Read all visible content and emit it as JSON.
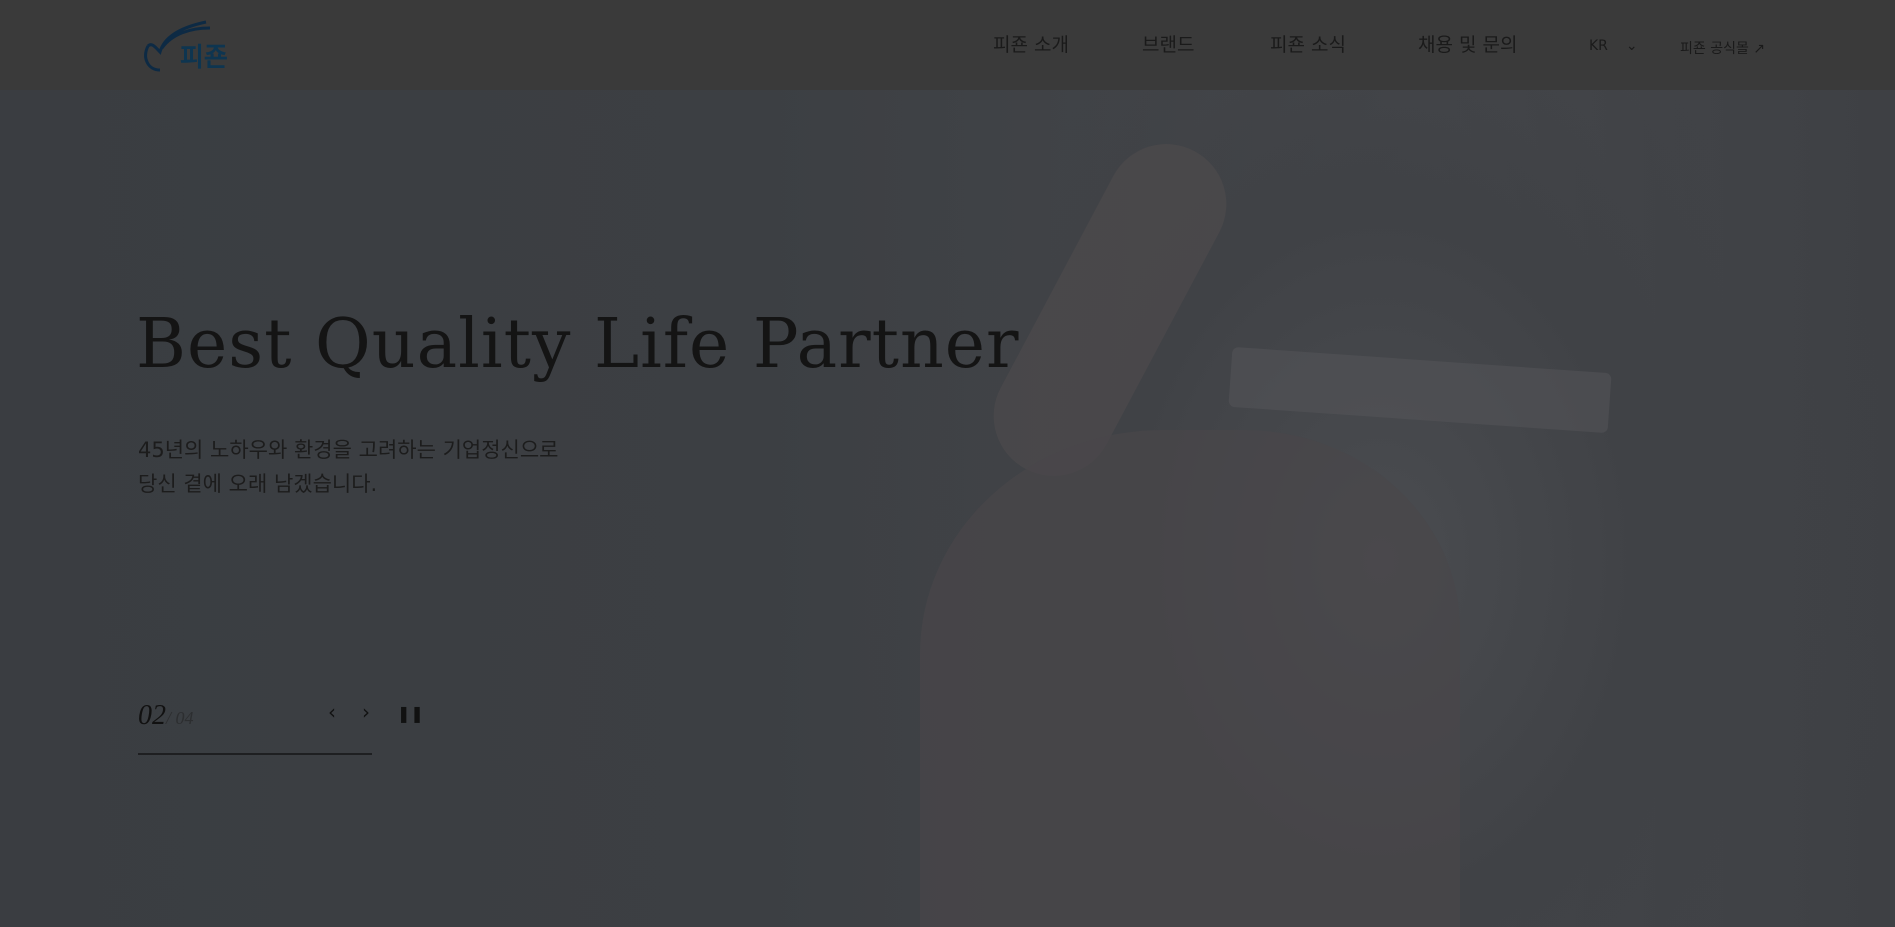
{
  "header": {
    "logo_text": "피죤",
    "nav": [
      "피죤 소개",
      "브랜드",
      "피죤 소식",
      "채용 및 문의"
    ],
    "lang": "KR",
    "shop_link": "피죤 공식몰 ↗"
  },
  "hero": {
    "title": "Best Quality Life Partner",
    "subtitle_lines": [
      "45년의 노하우와 환경을 고려하는 기업정신으로",
      "당신 곁에 오래 남겠습니다."
    ],
    "counter": {
      "current": "02",
      "total": "/ 04"
    },
    "progress": 0.5
  },
  "colors": {
    "logo": "#0d2a44",
    "overlay": "#3a3d41"
  }
}
